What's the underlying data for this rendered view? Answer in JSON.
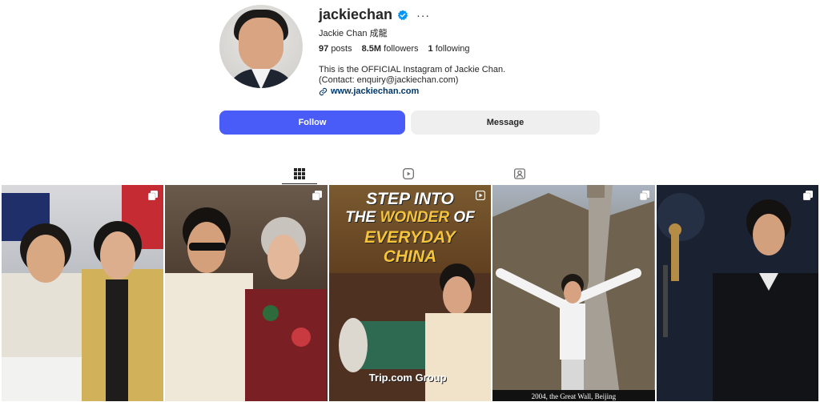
{
  "profile": {
    "username": "jackiechan",
    "full_name": "Jackie Chan 成龍",
    "posts_count": "97",
    "posts_label": "posts",
    "followers_count": "8.5M",
    "followers_label": "followers",
    "following_count": "1",
    "following_label": "following",
    "bio": "This is the OFFICIAL Instagram of Jackie Chan. (Contact: enquiry@jackiechan.com)",
    "link": "www.jackiechan.com",
    "verified_icon": "verified-badge-icon",
    "more_icon": "more-options-icon"
  },
  "actions": {
    "follow_label": "Follow",
    "message_label": "Message"
  },
  "tabs": [
    {
      "icon": "grid-icon",
      "active": true
    },
    {
      "icon": "reels-icon",
      "active": false
    },
    {
      "icon": "tagged-icon",
      "active": false
    }
  ],
  "posts": [
    {
      "badge_icon": "multi-image-icon"
    },
    {
      "badge_icon": "multi-image-icon"
    },
    {
      "badge_icon": "reel-icon",
      "promo_line1": "STEP INTO",
      "promo_line2_a": "THE ",
      "promo_line2_b": "WONDER",
      "promo_line2_c": " OF",
      "promo_line3": "EVERYDAY",
      "promo_line4": "CHINA",
      "brand": "Trip.com Group"
    },
    {
      "badge_icon": "multi-image-icon",
      "caption": "2004, the Great Wall, Beijing"
    },
    {
      "badge_icon": "multi-image-icon"
    }
  ],
  "colors": {
    "follow_button": "#4a5cf7",
    "message_button": "#efefef",
    "verified": "#0095f6",
    "link": "#00376b",
    "promo_accent": "#f6c43a"
  }
}
